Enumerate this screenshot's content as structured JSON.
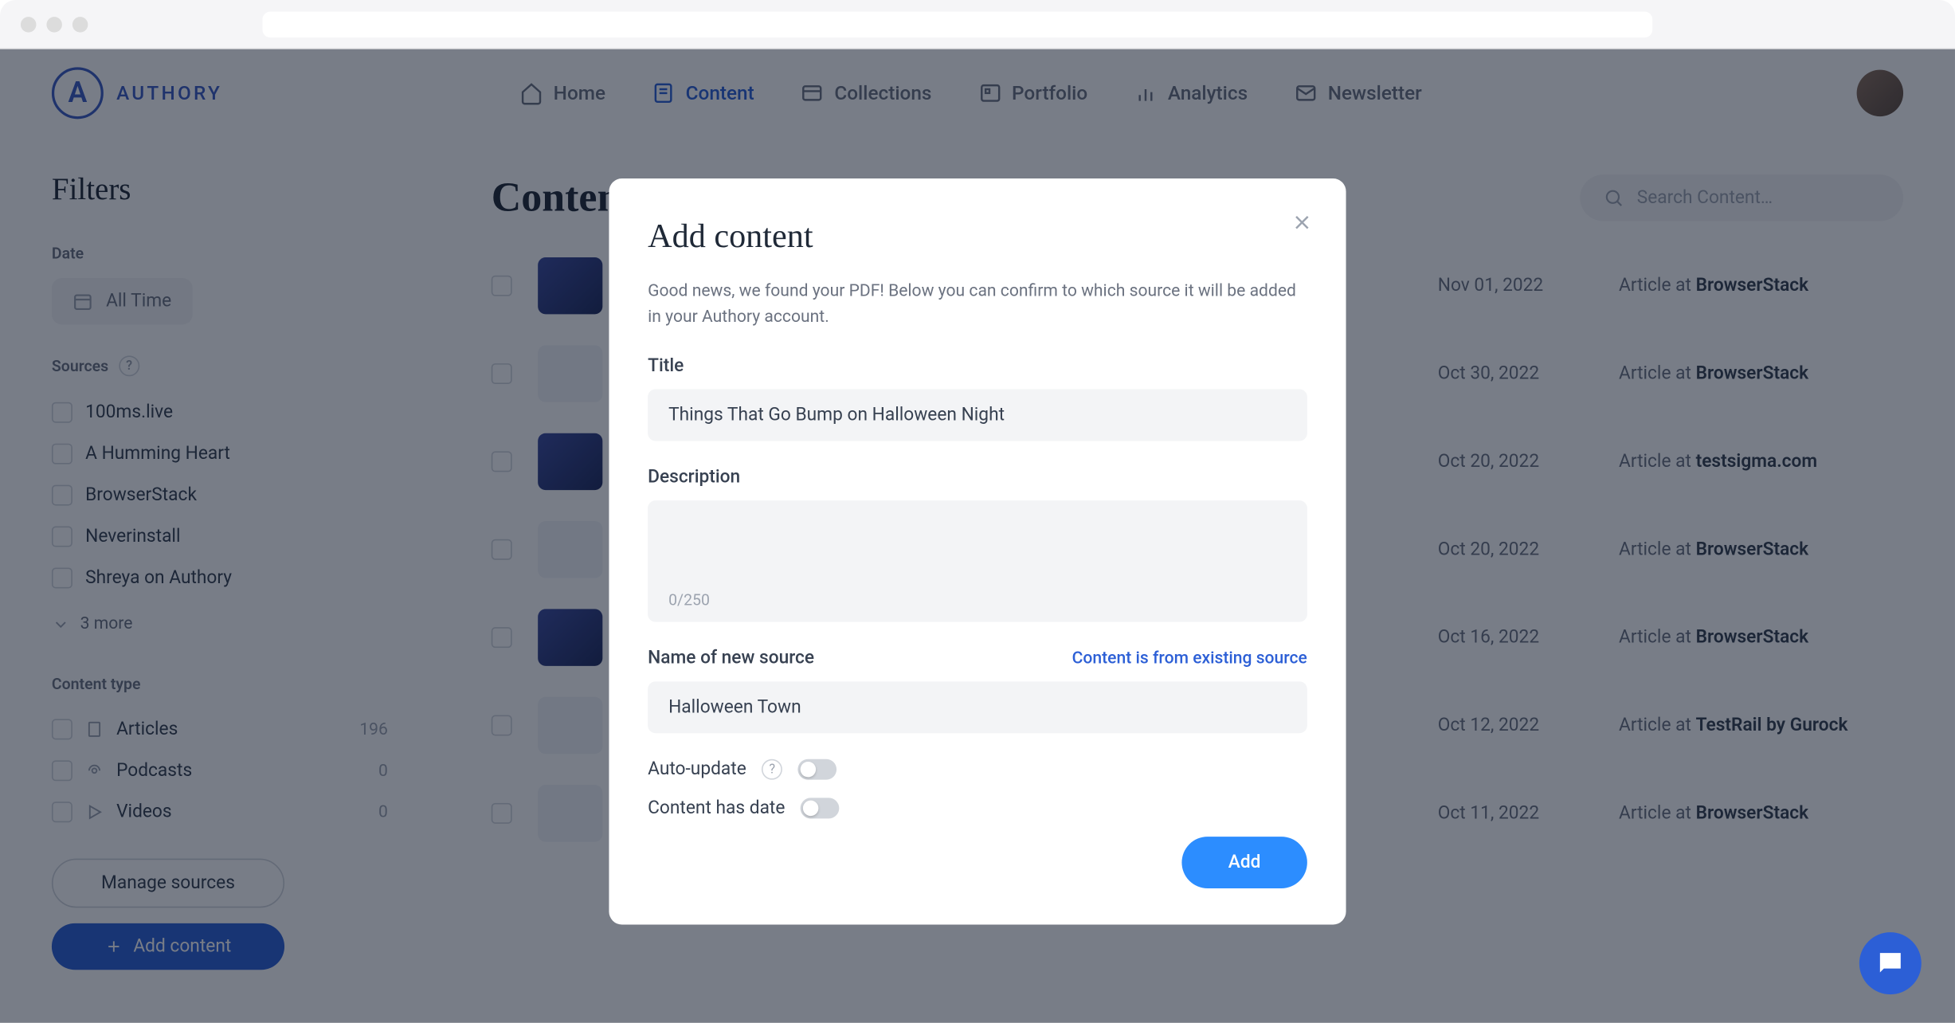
{
  "brand": "AUTHORY",
  "nav": {
    "home": "Home",
    "content": "Content",
    "collections": "Collections",
    "portfolio": "Portfolio",
    "analytics": "Analytics",
    "newsletter": "Newsletter"
  },
  "sidebar": {
    "title": "Filters",
    "date_label": "Date",
    "all_time": "All Time",
    "sources_label": "Sources",
    "sources": [
      {
        "label": "100ms.live"
      },
      {
        "label": "A Humming Heart"
      },
      {
        "label": "BrowserStack"
      },
      {
        "label": "Neverinstall"
      },
      {
        "label": "Shreya on Authory"
      }
    ],
    "more": "3 more",
    "content_type_label": "Content type",
    "types": [
      {
        "label": "Articles",
        "count": "196"
      },
      {
        "label": "Podcasts",
        "count": "0"
      },
      {
        "label": "Videos",
        "count": "0"
      }
    ],
    "manage": "Manage sources",
    "add_content": "Add content"
  },
  "main": {
    "title": "Content",
    "search_placeholder": "Search Content…",
    "article_prefix": "Article at ",
    "rows": [
      {
        "date": "Nov 01, 2022",
        "source": "BrowserStack"
      },
      {
        "date": "Oct 30, 2022",
        "source": "BrowserStack"
      },
      {
        "date": "Oct 20, 2022",
        "source": "testsigma.com"
      },
      {
        "date": "Oct 20, 2022",
        "source": "BrowserStack"
      },
      {
        "date": "Oct 16, 2022",
        "source": "BrowserStack"
      },
      {
        "date": "Oct 12, 2022",
        "source": "TestRail by Gurock"
      },
      {
        "date": "Oct 11, 2022",
        "source": "BrowserStack"
      }
    ]
  },
  "modal": {
    "title": "Add content",
    "desc": "Good news, we found your PDF! Below you can confirm to which source it will be added in your Authory account.",
    "title_label": "Title",
    "title_value": "Things That Go Bump on Halloween Night",
    "desc_label": "Description",
    "char_count": "0/250",
    "source_label": "Name of new source",
    "existing_link": "Content is from existing source",
    "source_value": "Halloween Town",
    "auto_update": "Auto-update",
    "has_date": "Content has date",
    "add_btn": "Add"
  }
}
